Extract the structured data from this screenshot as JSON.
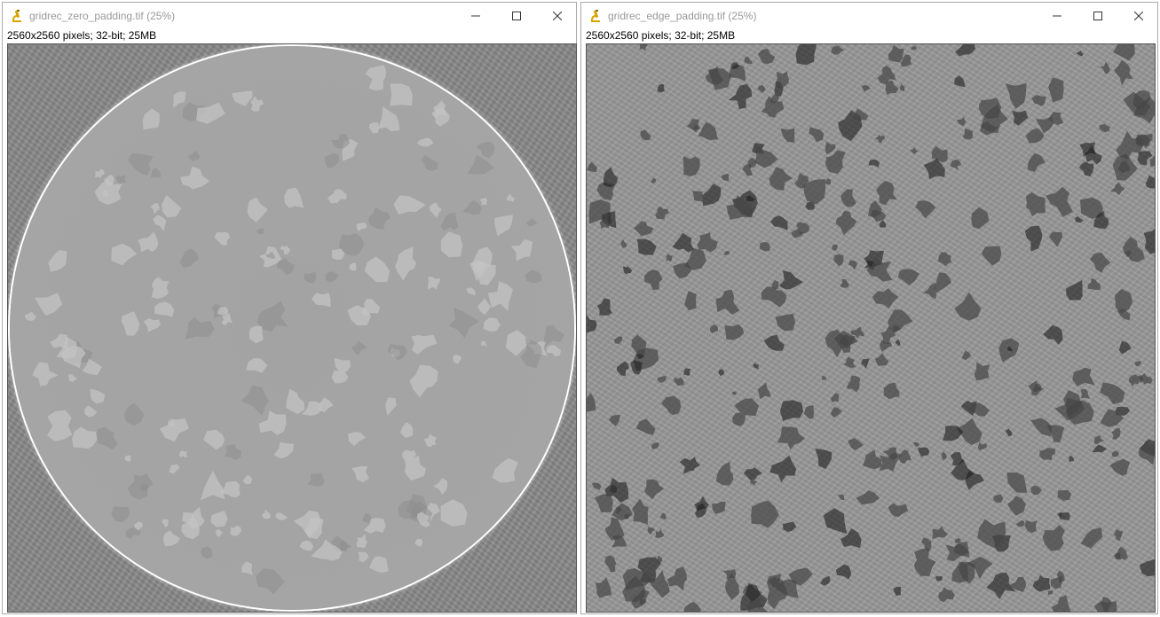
{
  "windows": [
    {
      "title": "gridrec_zero_padding.tif (25%)",
      "info": "2560x2560 pixels; 32-bit; 25MB",
      "icon": "imagej-microscope-icon"
    },
    {
      "title": "gridrec_edge_padding.tif (25%)",
      "info": "2560x2560 pixels; 32-bit; 25MB",
      "icon": "imagej-microscope-icon"
    }
  ],
  "controls": {
    "minimize": "minimize-icon",
    "maximize": "maximize-icon",
    "close": "close-icon"
  },
  "colors": {
    "title_text": "#999999",
    "info_text": "#000000",
    "icon_accent": "#d9a400"
  }
}
